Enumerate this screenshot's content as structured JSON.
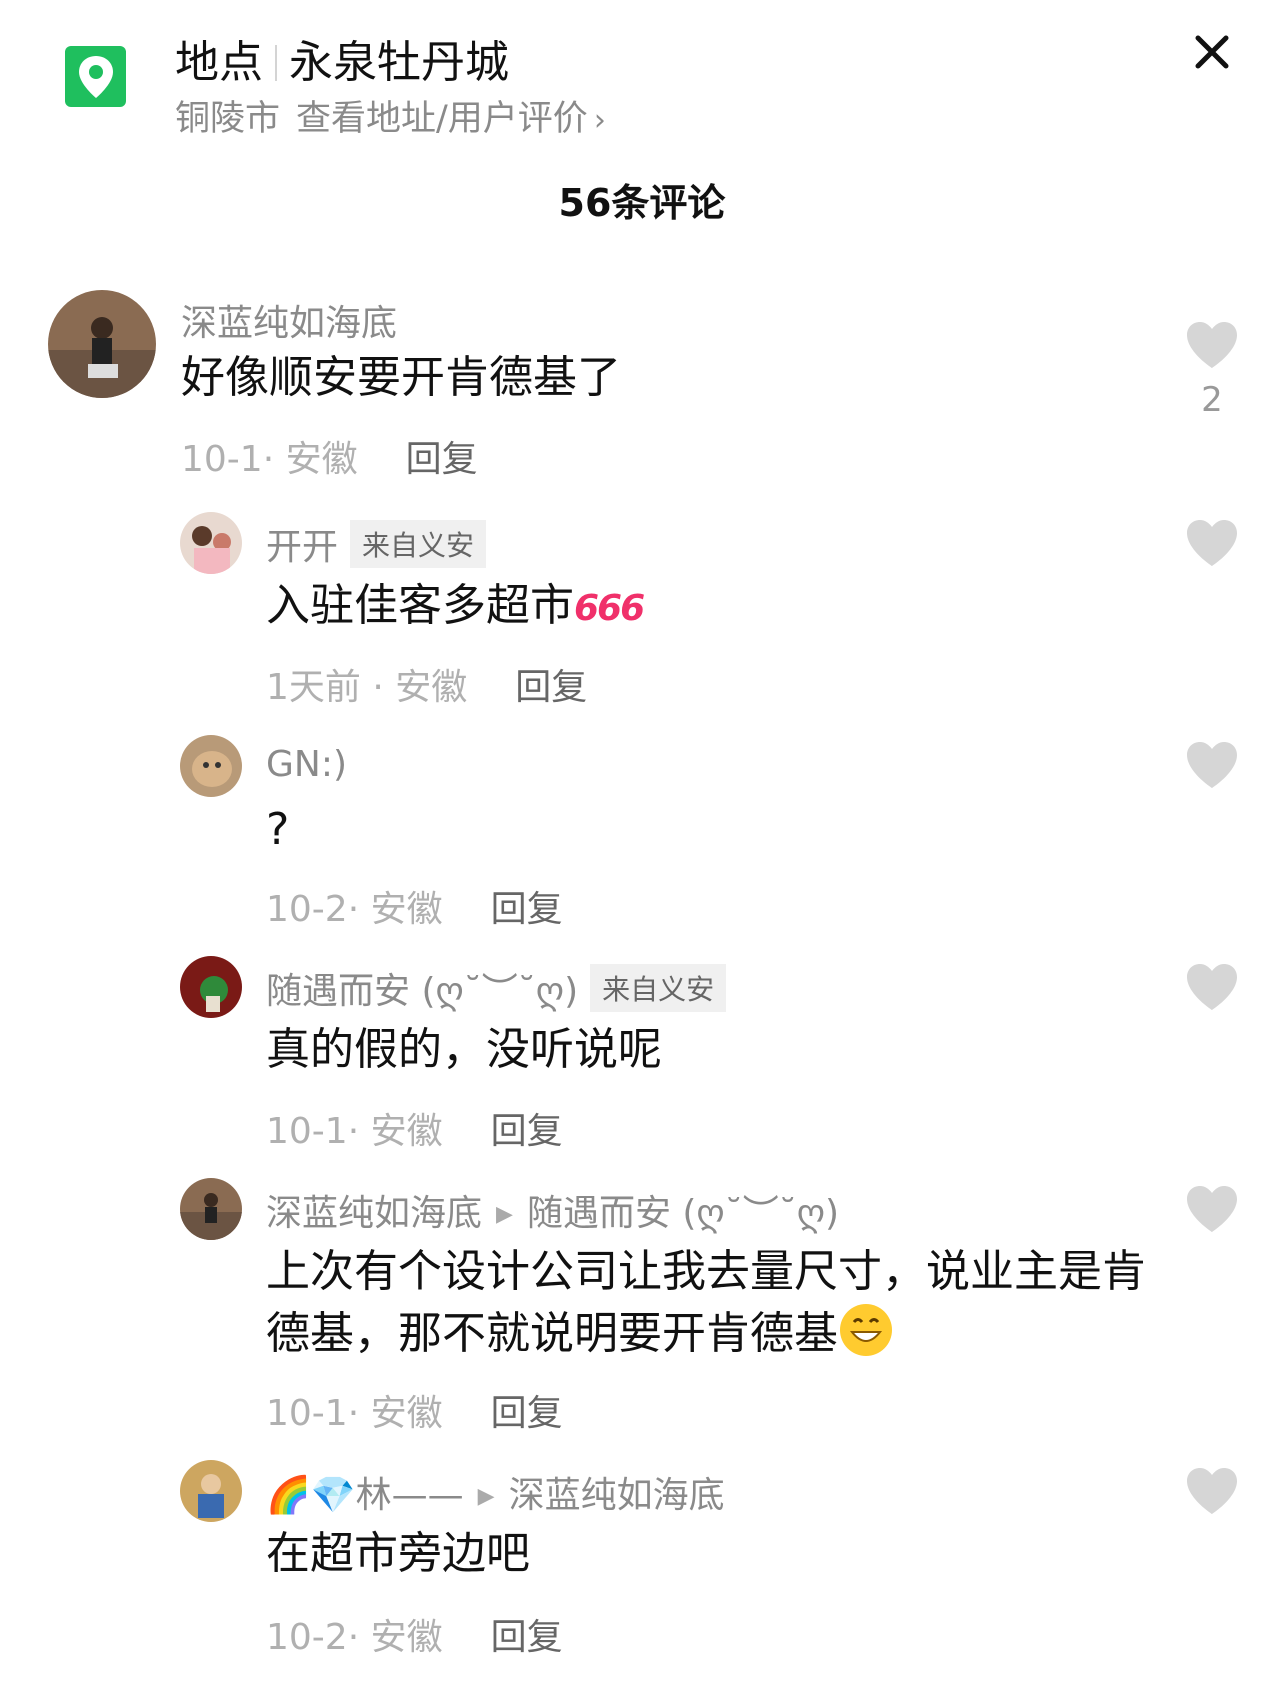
{
  "header": {
    "title_prefix": "地点",
    "title_place": "永泉牡丹城",
    "city": "铜陵市",
    "link_text": "查看地址/用户评价",
    "chevron": "›",
    "close": "×"
  },
  "comments_count": "56条评论",
  "comments": [
    {
      "user": "深蓝纯如海底",
      "text": "好像顺安要开肯德基了",
      "date": "10-1· 安徽",
      "reply": "回复",
      "likes": "2"
    },
    {
      "user": "开开",
      "tag": "来自义安",
      "text": "入驻佳客多超市",
      "emoji": "666",
      "date": "1天前 · 安徽",
      "reply": "回复"
    },
    {
      "user": "GN:)",
      "text": "?",
      "date": "10-2· 安徽",
      "reply": "回复"
    },
    {
      "user": "随遇而安 (ღ˘︶˘ღ)",
      "tag": "来自义安",
      "text": "真的假的，没听说呢",
      "date": "10-1· 安徽",
      "reply": "回复"
    },
    {
      "user": "深蓝纯如海底",
      "reply_to": "随遇而安 (ღ˘︶˘ღ)",
      "text": "上次有个设计公司让我去量尺寸，说业主是肯德基，那不就说明要开肯德基",
      "date": "10-1· 安徽",
      "reply": "回复"
    },
    {
      "user_emoji": "🌈💎",
      "user": "林——",
      "reply_to": "深蓝纯如海底",
      "text": "在超市旁边吧",
      "date": "10-2· 安徽",
      "reply": "回复"
    }
  ],
  "colors": {
    "location_icon": "#1fbf5e",
    "emoji_666": "#f0306a",
    "heart": "#d6d6d6"
  }
}
